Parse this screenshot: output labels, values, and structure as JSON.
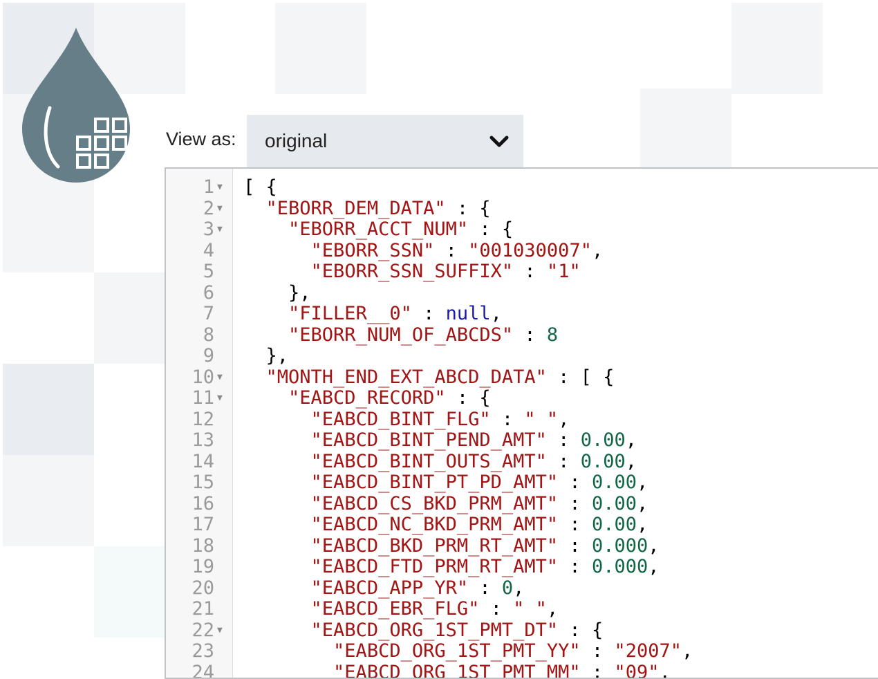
{
  "view_as": {
    "label": "View as:",
    "selected": "original"
  },
  "editor": {
    "lines": [
      {
        "num": "1",
        "fold": true,
        "indent": 0,
        "tokens": [
          {
            "t": "p",
            "v": "[ {"
          }
        ]
      },
      {
        "num": "2",
        "fold": true,
        "indent": 1,
        "tokens": [
          {
            "t": "k",
            "v": "\"EBORR_DEM_DATA\""
          },
          {
            "t": "p",
            "v": " : {"
          }
        ]
      },
      {
        "num": "3",
        "fold": true,
        "indent": 2,
        "tokens": [
          {
            "t": "k",
            "v": "\"EBORR_ACCT_NUM\""
          },
          {
            "t": "p",
            "v": " : {"
          }
        ]
      },
      {
        "num": "4",
        "fold": false,
        "indent": 3,
        "tokens": [
          {
            "t": "k",
            "v": "\"EBORR_SSN\""
          },
          {
            "t": "p",
            "v": " : "
          },
          {
            "t": "s",
            "v": "\"001030007\""
          },
          {
            "t": "p",
            "v": ","
          }
        ]
      },
      {
        "num": "5",
        "fold": false,
        "indent": 3,
        "tokens": [
          {
            "t": "k",
            "v": "\"EBORR_SSN_SUFFIX\""
          },
          {
            "t": "p",
            "v": " : "
          },
          {
            "t": "s",
            "v": "\"1\""
          }
        ]
      },
      {
        "num": "6",
        "fold": false,
        "indent": 2,
        "tokens": [
          {
            "t": "p",
            "v": "},"
          }
        ]
      },
      {
        "num": "7",
        "fold": false,
        "indent": 2,
        "tokens": [
          {
            "t": "k",
            "v": "\"FILLER__0\""
          },
          {
            "t": "p",
            "v": " : "
          },
          {
            "t": "nl",
            "v": "null"
          },
          {
            "t": "p",
            "v": ","
          }
        ]
      },
      {
        "num": "8",
        "fold": false,
        "indent": 2,
        "tokens": [
          {
            "t": "k",
            "v": "\"EBORR_NUM_OF_ABCDS\""
          },
          {
            "t": "p",
            "v": " : "
          },
          {
            "t": "n",
            "v": "8"
          }
        ]
      },
      {
        "num": "9",
        "fold": false,
        "indent": 1,
        "tokens": [
          {
            "t": "p",
            "v": "},"
          }
        ]
      },
      {
        "num": "10",
        "fold": true,
        "indent": 1,
        "tokens": [
          {
            "t": "k",
            "v": "\"MONTH_END_EXT_ABCD_DATA\""
          },
          {
            "t": "p",
            "v": " : [ {"
          }
        ]
      },
      {
        "num": "11",
        "fold": true,
        "indent": 2,
        "tokens": [
          {
            "t": "k",
            "v": "\"EABCD_RECORD\""
          },
          {
            "t": "p",
            "v": " : {"
          }
        ]
      },
      {
        "num": "12",
        "fold": false,
        "indent": 3,
        "tokens": [
          {
            "t": "k",
            "v": "\"EABCD_BINT_FLG\""
          },
          {
            "t": "p",
            "v": " : "
          },
          {
            "t": "s",
            "v": "\" \""
          },
          {
            "t": "p",
            "v": ","
          }
        ]
      },
      {
        "num": "13",
        "fold": false,
        "indent": 3,
        "tokens": [
          {
            "t": "k",
            "v": "\"EABCD_BINT_PEND_AMT\""
          },
          {
            "t": "p",
            "v": " : "
          },
          {
            "t": "n",
            "v": "0.00"
          },
          {
            "t": "p",
            "v": ","
          }
        ]
      },
      {
        "num": "14",
        "fold": false,
        "indent": 3,
        "tokens": [
          {
            "t": "k",
            "v": "\"EABCD_BINT_OUTS_AMT\""
          },
          {
            "t": "p",
            "v": " : "
          },
          {
            "t": "n",
            "v": "0.00"
          },
          {
            "t": "p",
            "v": ","
          }
        ]
      },
      {
        "num": "15",
        "fold": false,
        "indent": 3,
        "tokens": [
          {
            "t": "k",
            "v": "\"EABCD_BINT_PT_PD_AMT\""
          },
          {
            "t": "p",
            "v": " : "
          },
          {
            "t": "n",
            "v": "0.00"
          },
          {
            "t": "p",
            "v": ","
          }
        ]
      },
      {
        "num": "16",
        "fold": false,
        "indent": 3,
        "tokens": [
          {
            "t": "k",
            "v": "\"EABCD_CS_BKD_PRM_AMT\""
          },
          {
            "t": "p",
            "v": " : "
          },
          {
            "t": "n",
            "v": "0.00"
          },
          {
            "t": "p",
            "v": ","
          }
        ]
      },
      {
        "num": "17",
        "fold": false,
        "indent": 3,
        "tokens": [
          {
            "t": "k",
            "v": "\"EABCD_NC_BKD_PRM_AMT\""
          },
          {
            "t": "p",
            "v": " : "
          },
          {
            "t": "n",
            "v": "0.00"
          },
          {
            "t": "p",
            "v": ","
          }
        ]
      },
      {
        "num": "18",
        "fold": false,
        "indent": 3,
        "tokens": [
          {
            "t": "k",
            "v": "\"EABCD_BKD_PRM_RT_AMT\""
          },
          {
            "t": "p",
            "v": " : "
          },
          {
            "t": "n",
            "v": "0.000"
          },
          {
            "t": "p",
            "v": ","
          }
        ]
      },
      {
        "num": "19",
        "fold": false,
        "indent": 3,
        "tokens": [
          {
            "t": "k",
            "v": "\"EABCD_FTD_PRM_RT_AMT\""
          },
          {
            "t": "p",
            "v": " : "
          },
          {
            "t": "n",
            "v": "0.000"
          },
          {
            "t": "p",
            "v": ","
          }
        ]
      },
      {
        "num": "20",
        "fold": false,
        "indent": 3,
        "tokens": [
          {
            "t": "k",
            "v": "\"EABCD_APP_YR\""
          },
          {
            "t": "p",
            "v": " : "
          },
          {
            "t": "n",
            "v": "0"
          },
          {
            "t": "p",
            "v": ","
          }
        ]
      },
      {
        "num": "21",
        "fold": false,
        "indent": 3,
        "tokens": [
          {
            "t": "k",
            "v": "\"EABCD_EBR_FLG\""
          },
          {
            "t": "p",
            "v": " : "
          },
          {
            "t": "s",
            "v": "\" \""
          },
          {
            "t": "p",
            "v": ","
          }
        ]
      },
      {
        "num": "22",
        "fold": true,
        "indent": 3,
        "tokens": [
          {
            "t": "k",
            "v": "\"EABCD_ORG_1ST_PMT_DT\""
          },
          {
            "t": "p",
            "v": " : {"
          }
        ]
      },
      {
        "num": "23",
        "fold": false,
        "indent": 4,
        "tokens": [
          {
            "t": "k",
            "v": "\"EABCD_ORG_1ST_PMT_YY\""
          },
          {
            "t": "p",
            "v": " : "
          },
          {
            "t": "s",
            "v": "\"2007\""
          },
          {
            "t": "p",
            "v": ","
          }
        ]
      },
      {
        "num": "24",
        "fold": false,
        "indent": 4,
        "tokens": [
          {
            "t": "k",
            "v": "\"EABCD_ORG_1ST_PMT_MM\""
          },
          {
            "t": "p",
            "v": " : "
          },
          {
            "t": "s",
            "v": "\"09\""
          },
          {
            "t": "p",
            "v": ","
          }
        ]
      }
    ]
  }
}
